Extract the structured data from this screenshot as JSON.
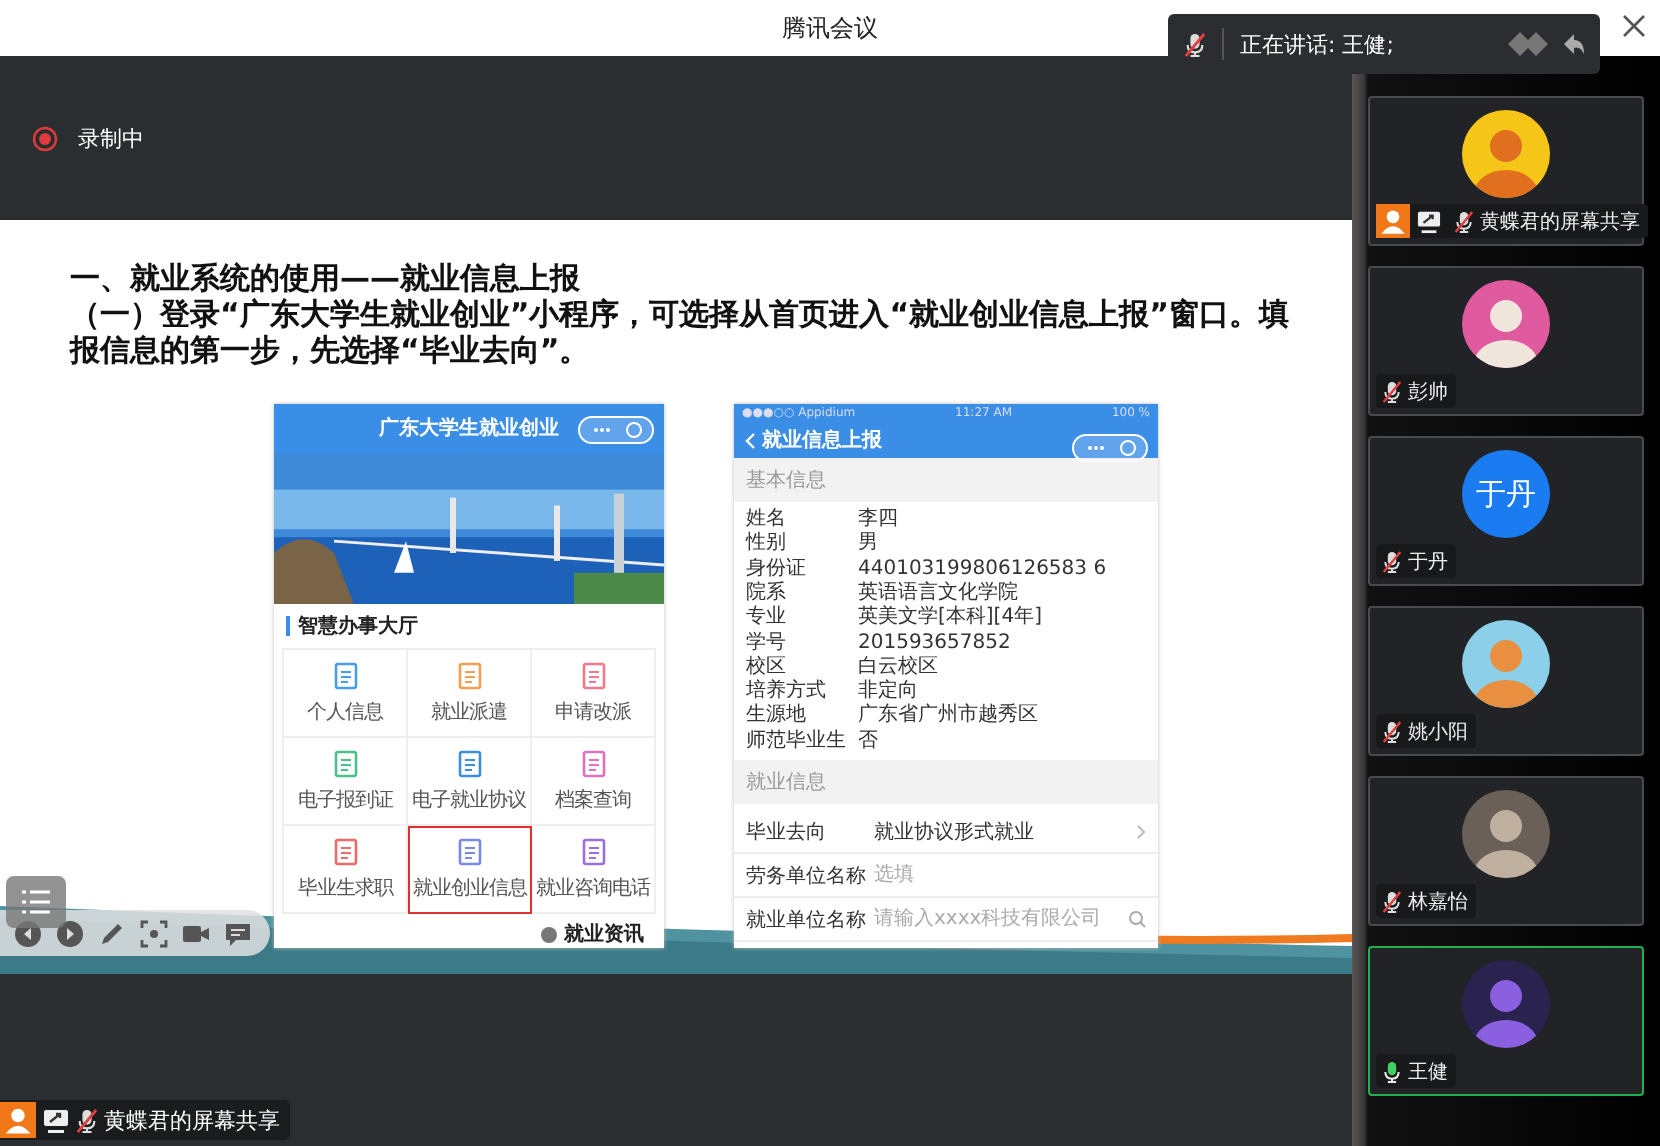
{
  "window": {
    "title": "腾讯会议"
  },
  "speaker_popup": {
    "label": "正在讲话: 王健;",
    "mic_muted": true
  },
  "recording": {
    "label": "录制中"
  },
  "slide": {
    "heading": "一、就业系统的使用——就业信息上报",
    "body": "（一）登录“广东大学生就业创业”小程序，可选择从首页进入“就业创业信息上报”窗口。填报信息的第一步，先选择“毕业去向”。",
    "phone_home": {
      "title": "广东大学生就业创业",
      "section": "智慧办事大厅",
      "bottom_tab": "就业资讯",
      "services": [
        {
          "label": "个人信息",
          "color": "#4a9ee8",
          "selected": false
        },
        {
          "label": "就业派遣",
          "color": "#f0a050",
          "selected": false
        },
        {
          "label": "申请改派",
          "color": "#f07a8a",
          "selected": false
        },
        {
          "label": "电子报到证",
          "color": "#4cc08a",
          "selected": false
        },
        {
          "label": "电子就业协议",
          "color": "#3a8ee0",
          "selected": false
        },
        {
          "label": "档案查询",
          "color": "#e070c0",
          "selected": false
        },
        {
          "label": "毕业生求职",
          "color": "#f06a6a",
          "selected": false
        },
        {
          "label": "就业创业信息",
          "color": "#7a8ae0",
          "selected": true
        },
        {
          "label": "就业咨询电话",
          "color": "#9a70e0",
          "selected": false
        }
      ]
    },
    "phone_form": {
      "carrier": "●●●○○ Appidium",
      "time": "11:27 AM",
      "battery": "100 %",
      "title": "就业信息上报",
      "sections": [
        {
          "title": "基本信息",
          "rows": [
            {
              "kind": "text",
              "label": "姓名",
              "value": "李四"
            },
            {
              "kind": "text",
              "label": "性别",
              "value": "男"
            },
            {
              "kind": "text",
              "label": "身份证",
              "value": "440103199806126583 6"
            },
            {
              "kind": "text",
              "label": "院系",
              "value": "英语语言文化学院"
            },
            {
              "kind": "text",
              "label": "专业",
              "value": "英美文学[本科][4年]"
            },
            {
              "kind": "text",
              "label": "学号",
              "value": "201593657852"
            },
            {
              "kind": "text",
              "label": "校区",
              "value": "白云校区"
            },
            {
              "kind": "text",
              "label": "培养方式",
              "value": "非定向"
            },
            {
              "kind": "text",
              "label": "生源地",
              "value": "广东省广州市越秀区"
            },
            {
              "kind": "text",
              "label": "师范毕业生",
              "value": "否"
            }
          ]
        },
        {
          "title": "就业信息",
          "rows": [
            {
              "kind": "select",
              "label": "毕业去向",
              "value": "就业协议形式就业"
            },
            {
              "kind": "input",
              "label": "劳务单位名称",
              "placeholder": "选填"
            },
            {
              "kind": "search",
              "label": "就业单位名称",
              "placeholder": "请输入xxxx科技有限公司"
            }
          ]
        }
      ]
    }
  },
  "share_tag": {
    "name": "黄蝶君的屏幕共享",
    "host": true,
    "sharing": true,
    "muted": true
  },
  "participants": [
    {
      "name": "黄蝶君的屏幕共享",
      "host": true,
      "sharing": true,
      "muted": true,
      "speaking": false
    },
    {
      "name": "彭帅",
      "host": false,
      "sharing": false,
      "muted": true,
      "speaking": false
    },
    {
      "name": "于丹",
      "avatar_text": "于丹",
      "host": false,
      "sharing": false,
      "muted": true,
      "speaking": false
    },
    {
      "name": "姚小阳",
      "host": false,
      "sharing": false,
      "muted": true,
      "speaking": false
    },
    {
      "name": "林嘉怡",
      "host": false,
      "sharing": false,
      "muted": true,
      "speaking": false
    },
    {
      "name": "王健",
      "host": false,
      "sharing": false,
      "muted": false,
      "speaking": true
    }
  ]
}
